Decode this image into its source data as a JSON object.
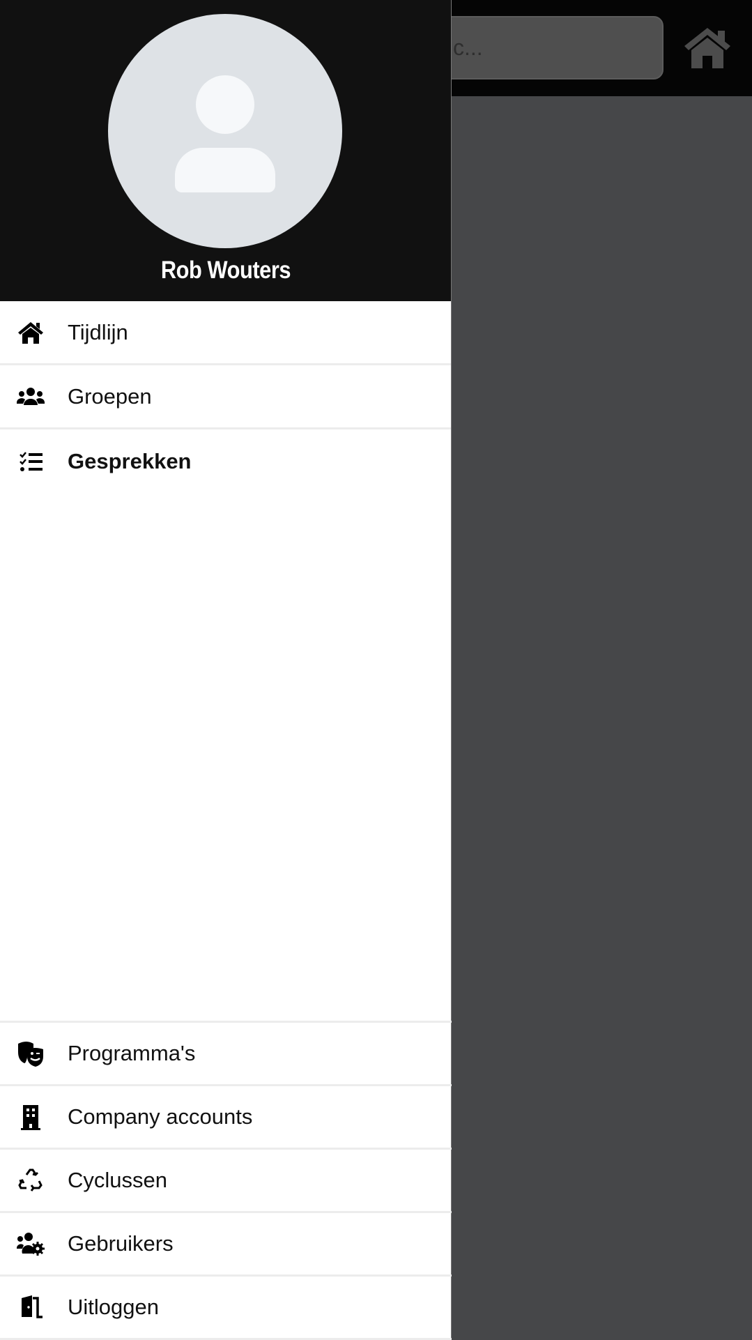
{
  "topbar": {
    "search_placeholder": "c...",
    "home_icon": "home-icon"
  },
  "drawer": {
    "user_name": "Rob Wouters",
    "avatar_icon": "user-icon",
    "nav_items": [
      {
        "label": "Tijdlijn",
        "icon": "home-icon"
      },
      {
        "label": "Groepen",
        "icon": "users-icon"
      },
      {
        "label": "Gesprekken",
        "icon": "tasks-list-icon",
        "active": true
      }
    ],
    "bottom_items": [
      {
        "label": "Programma's",
        "icon": "theater-masks-icon"
      },
      {
        "label": "Company accounts",
        "icon": "building-icon"
      },
      {
        "label": "Cyclussen",
        "icon": "recycle-icon"
      },
      {
        "label": "Gebruikers",
        "icon": "users-cog-icon"
      },
      {
        "label": "Uitloggen",
        "icon": "door-open-icon"
      }
    ]
  },
  "colors": {
    "drawer_header": "#111111",
    "overlay": "#464749",
    "topbar": "#050505"
  }
}
